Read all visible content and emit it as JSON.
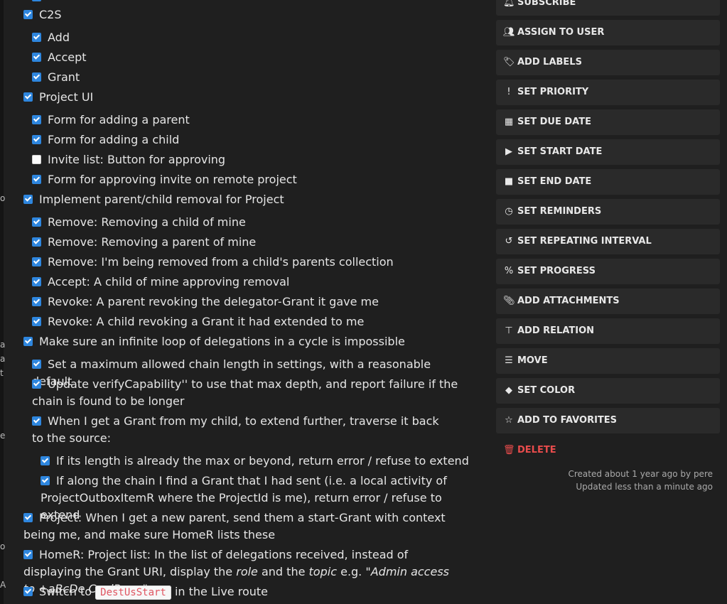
{
  "tasks": [
    {
      "label": "C2S",
      "checked": true
    },
    {
      "label": "Add",
      "checked": true
    },
    {
      "label": "Accept",
      "checked": true
    },
    {
      "label": "Grant",
      "checked": true
    },
    {
      "label": "Project UI",
      "checked": true
    },
    {
      "label": "Form for adding a parent",
      "checked": true
    },
    {
      "label": "Form for adding a child",
      "checked": true
    },
    {
      "label": "Invite list: Button for approving",
      "checked": false
    },
    {
      "label": "Form for approving invite on remote project",
      "checked": true
    },
    {
      "label": "Implement parent/child removal for Project",
      "checked": true
    },
    {
      "label": "Remove: Removing a child of mine",
      "checked": true
    },
    {
      "label": "Remove: Removing a parent of mine",
      "checked": true
    },
    {
      "label": "Remove: I'm being removed from a child's parents collection",
      "checked": true
    },
    {
      "label": "Accept: A child of mine approving removal",
      "checked": true
    },
    {
      "label": "Revoke: A parent revoking the delegator-Grant it gave me",
      "checked": true
    },
    {
      "label": "Revoke: A child revoking a Grant it had extended to me",
      "checked": true
    },
    {
      "label": "Make sure an infinite loop of delegations in a cycle is impossible",
      "checked": true
    },
    {
      "label": "Set a maximum allowed chain length in settings, with a reasonable default",
      "checked": true
    },
    {
      "label": "Update verifyCapability'' to use that max depth, and report failure if the chain is found to be longer",
      "checked": true
    },
    {
      "label": "When I get a Grant from my child, to extend further, traverse it back to the source:",
      "checked": true
    },
    {
      "label": "If its length is already the max or beyond, return error / refuse to extend",
      "checked": true
    },
    {
      "label": "If along the chain I find a Grant that I had sent (i.e. a local activity of ProjectOutboxItemR where the ProjectId is me), return error / refuse to extend",
      "checked": true
    },
    {
      "label": "Project: When I get a new parent, send them a start-Grant with context being me, and make sure HomeR lists these",
      "checked": true
    }
  ],
  "homer_task": {
    "prefix": "HomeR: Project list: In the list of delegations received, instead of displaying the Grant URI, display the",
    "role": "role",
    "and_the": "and the",
    "topic": "topic",
    "eg": "e.g.",
    "example": "\"Admin access to +aBcDe CoolRepo\"",
    "checked": true
  },
  "switch_task": {
    "prefix": "Switch to",
    "code": "DestUsStart",
    "suffix": "in the Live route",
    "checked": true
  },
  "gutter": [
    "o",
    "a",
    "a",
    "t",
    "e",
    "o",
    "A"
  ],
  "sidebar": {
    "buttons": [
      {
        "label": "SUBSCRIBE",
        "icon": "bell-icon"
      },
      {
        "label": "ASSIGN TO USER",
        "icon": "users-icon"
      },
      {
        "label": "ADD LABELS",
        "icon": "tags-icon"
      },
      {
        "label": "SET PRIORITY",
        "icon": "exclamation-icon"
      },
      {
        "label": "SET DUE DATE",
        "icon": "calendar-icon"
      },
      {
        "label": "SET START DATE",
        "icon": "play-icon"
      },
      {
        "label": "SET END DATE",
        "icon": "stop-icon"
      },
      {
        "label": "SET REMINDERS",
        "icon": "clock-icon"
      },
      {
        "label": "SET REPEATING INTERVAL",
        "icon": "history-icon"
      },
      {
        "label": "SET PROGRESS",
        "icon": "percent-icon"
      },
      {
        "label": "ADD ATTACHMENTS",
        "icon": "paperclip-icon"
      },
      {
        "label": "ADD RELATION",
        "icon": "sitemap-icon"
      },
      {
        "label": "MOVE",
        "icon": "list-icon"
      },
      {
        "label": "SET COLOR",
        "icon": "fill-icon"
      },
      {
        "label": "ADD TO FAVORITES",
        "icon": "star-icon"
      },
      {
        "label": "DELETE",
        "icon": "trash-icon"
      }
    ],
    "created": "Created about 1 year ago by pere",
    "updated": "Updated less than a minute ago"
  }
}
